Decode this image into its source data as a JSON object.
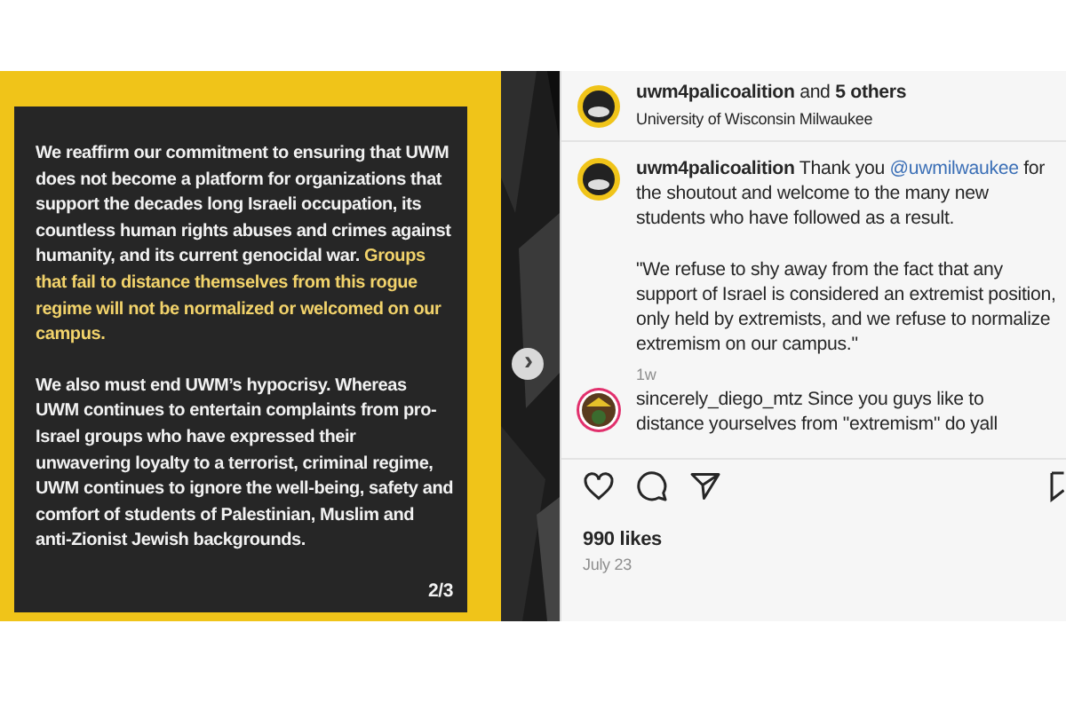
{
  "slide": {
    "paragraphs": [
      [
        {
          "text": "We reaffirm our commitment to ensuring that UWM does not become a platform for organizations that support the decades long Israeli occupation, its countless human rights abuses and crimes against humanity, and its current genocidal war. ",
          "highlight": false
        },
        {
          "text": "Groups that fail to distance themselves from this rogue regime will not be normalized or welcomed on our campus.",
          "highlight": true
        }
      ],
      [
        {
          "text": "We also must end UWM’s hypocrisy. Whereas UWM continues to entertain complaints from pro-Israel groups who have expressed their unwavering loyalty to a terrorist, criminal regime, UWM continues to ignore the well-being, safety and comfort of students of Palestinian, Muslim and anti-Zionist Jewish backgrounds.",
          "highlight": false
        }
      ]
    ],
    "counter": "2/3",
    "next_button": "›"
  },
  "header": {
    "title": "**uwm4palicoalition** and **5 others**",
    "location": "University of Wisconsin Milwaukee"
  },
  "caption": {
    "username": "uwm4palicoalition",
    "before": "Thank you",
    "mention": "@uwmilwaukee",
    "after": "for the shoutout and welcome to the many new students who have followed as a result.",
    "quote": "\"We refuse to shy away from the fact that any support of Israel is considered an extremist position, only held by extremists, and we refuse to normalize extremism on our campus.\"",
    "time": "1w"
  },
  "comment": {
    "username": "sincerely_diego_mtz",
    "text": "Since you guys like to distance yourselves from \"extremism\" do yall"
  },
  "likes": "990 likes",
  "date": "July 23"
}
